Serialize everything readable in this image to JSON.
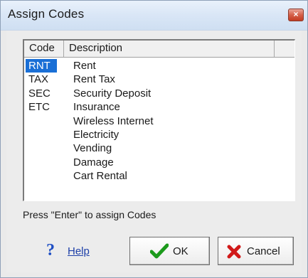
{
  "window": {
    "title": "Assign Codes",
    "close_glyph": "×"
  },
  "list": {
    "columns": [
      "Code",
      "Description"
    ],
    "rows": [
      {
        "code": "RNT",
        "description": "Rent",
        "selected": true
      },
      {
        "code": "TAX",
        "description": "Rent Tax",
        "selected": false
      },
      {
        "code": "SEC",
        "description": "Security Deposit",
        "selected": false
      },
      {
        "code": "ETC",
        "description": "Insurance",
        "selected": false
      },
      {
        "code": "",
        "description": "Wireless Internet",
        "selected": false
      },
      {
        "code": "",
        "description": "Electricity",
        "selected": false
      },
      {
        "code": "",
        "description": "Vending",
        "selected": false
      },
      {
        "code": "",
        "description": "Damage",
        "selected": false
      },
      {
        "code": "",
        "description": "Cart Rental",
        "selected": false
      }
    ]
  },
  "status": {
    "text": "Press \"Enter\" to assign Codes"
  },
  "help": {
    "icon": "question-mark-icon",
    "label": "Help"
  },
  "buttons": {
    "ok": {
      "label": "OK",
      "icon": "checkmark-icon"
    },
    "cancel": {
      "label": "Cancel",
      "icon": "x-icon"
    }
  },
  "colors": {
    "selection": "#1a6fd6",
    "ok_icon": "#1c9a1c",
    "cancel_icon": "#d11a1a",
    "help_icon": "#1f4fc4"
  }
}
